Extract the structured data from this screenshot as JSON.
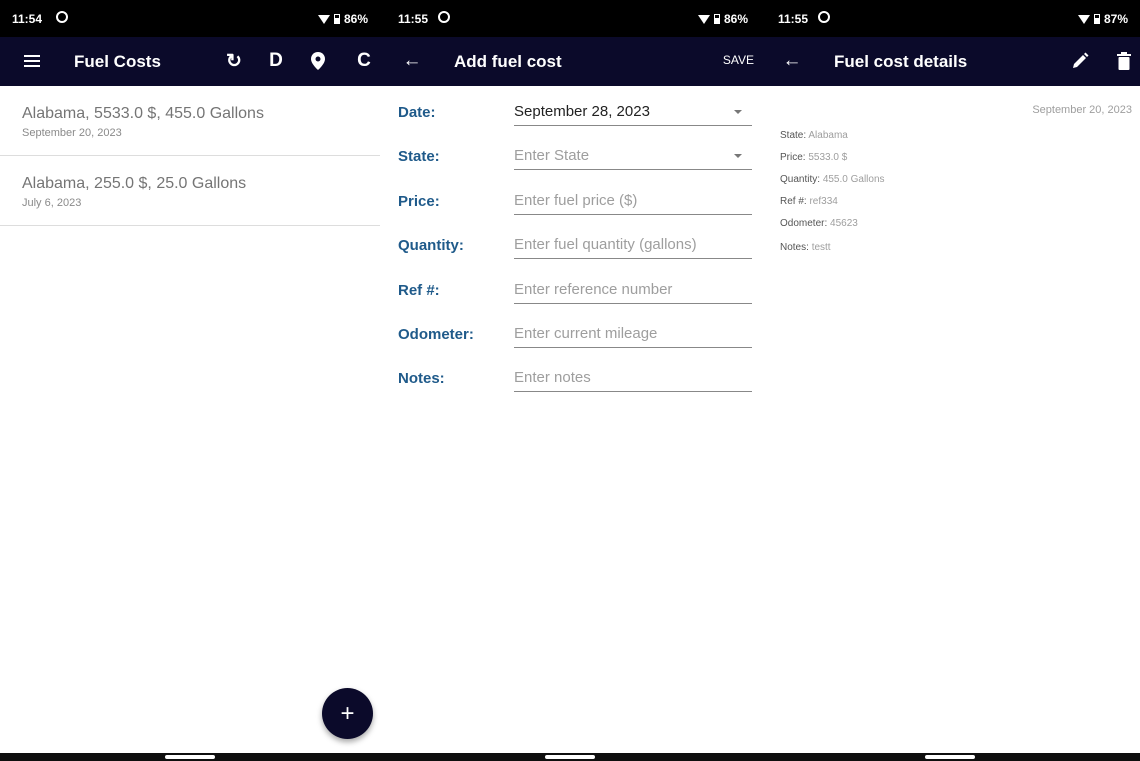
{
  "colors": {
    "app_bar": "#0b0a2a",
    "label_blue": "#1f5a8a",
    "status_bar": "#000000"
  },
  "screen1": {
    "status": {
      "time": "11:54",
      "battery": "86%"
    },
    "app_bar": {
      "title": "Fuel Costs",
      "actions": [
        {
          "icon": "sync-icon",
          "glyph": "↻"
        },
        {
          "icon": "d-letter-icon",
          "glyph": "D"
        },
        {
          "icon": "location-pin-icon",
          "glyph": ""
        },
        {
          "icon": "refresh-icon",
          "glyph": "C"
        }
      ]
    },
    "items": [
      {
        "primary": "Alabama, 5533.0 $, 455.0 Gallons",
        "secondary": "September 20, 2023"
      },
      {
        "primary": "Alabama, 255.0 $, 25.0 Gallons",
        "secondary": "July 6, 2023"
      }
    ],
    "fab_label": "+"
  },
  "screen2": {
    "status": {
      "time": "11:55",
      "battery": "86%"
    },
    "app_bar": {
      "title": "Add fuel cost",
      "save_label": "SAVE",
      "back_glyph": "←"
    },
    "fields": [
      {
        "label": "Date:",
        "value": "September 28, 2023",
        "placeholder": "",
        "dropdown": true
      },
      {
        "label": "State:",
        "value": "",
        "placeholder": "Enter State",
        "dropdown": true
      },
      {
        "label": "Price:",
        "value": "",
        "placeholder": "Enter fuel price ($)",
        "dropdown": false
      },
      {
        "label": "Quantity:",
        "value": "",
        "placeholder": "Enter fuel quantity (gallons)",
        "dropdown": false
      },
      {
        "label": "Ref #:",
        "value": "",
        "placeholder": "Enter reference number",
        "dropdown": false
      },
      {
        "label": "Odometer:",
        "value": "",
        "placeholder": "Enter current mileage",
        "dropdown": false
      },
      {
        "label": "Notes:",
        "value": "",
        "placeholder": "Enter notes",
        "dropdown": false
      }
    ]
  },
  "screen3": {
    "status": {
      "time": "11:55",
      "battery": "87%"
    },
    "app_bar": {
      "title": "Fuel cost details",
      "back_glyph": "←"
    },
    "date": "September 20, 2023",
    "details": [
      {
        "key": "State:",
        "value": "Alabama"
      },
      {
        "key": "Price:",
        "value": "5533.0 $"
      },
      {
        "key": "Quantity:",
        "value": "455.0 Gallons"
      },
      {
        "key": "Ref #:",
        "value": "ref334"
      },
      {
        "key": "Odometer:",
        "value": "45623"
      },
      {
        "key": "Notes:",
        "value": "testt"
      }
    ]
  }
}
